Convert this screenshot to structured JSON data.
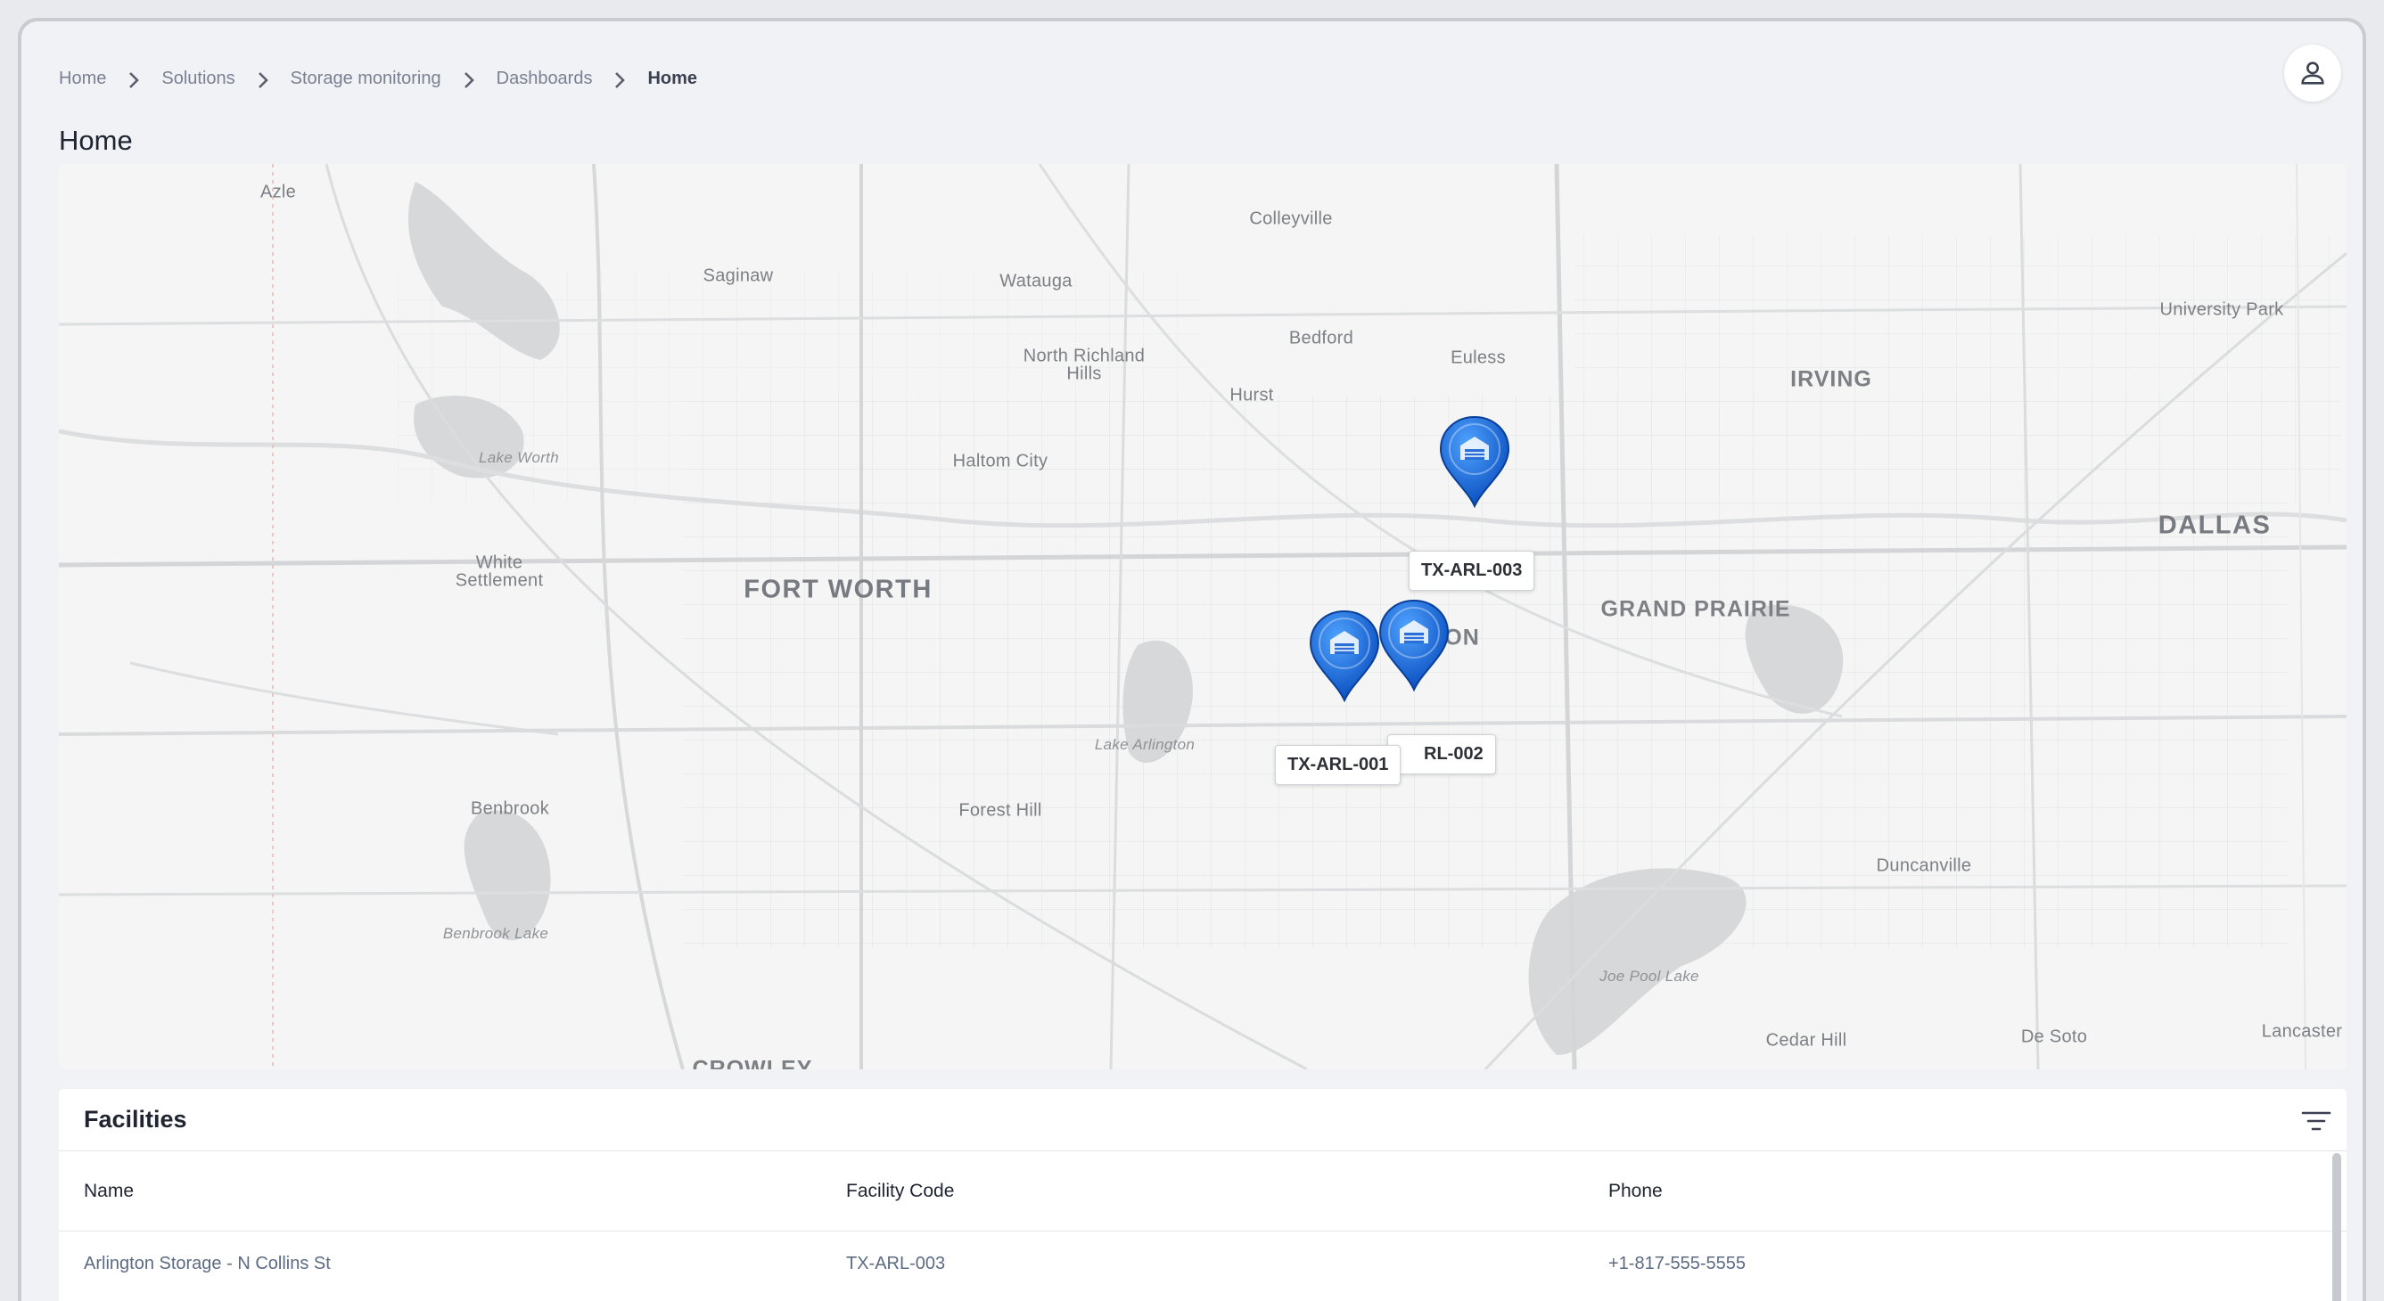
{
  "breadcrumb": {
    "items": [
      "Home",
      "Solutions",
      "Storage monitoring",
      "Dashboards",
      "Home"
    ]
  },
  "page": {
    "title": "Home"
  },
  "map": {
    "places": [
      {
        "name": "Azle",
        "kind": "small"
      },
      {
        "name": "Colleyville",
        "kind": "small"
      },
      {
        "name": "Saginaw",
        "kind": "small"
      },
      {
        "name": "Watauga",
        "kind": "small"
      },
      {
        "name": "North Richland",
        "kind": "small"
      },
      {
        "name": "Hills",
        "kind": "small"
      },
      {
        "name": "Bedford",
        "kind": "small"
      },
      {
        "name": "Euless",
        "kind": "small"
      },
      {
        "name": "Hurst",
        "kind": "small"
      },
      {
        "name": "University Park",
        "kind": "small"
      },
      {
        "name": "IRVING",
        "kind": "mid"
      },
      {
        "name": "Lake Worth",
        "kind": "water"
      },
      {
        "name": "Haltom City",
        "kind": "small"
      },
      {
        "name": "DALLAS",
        "kind": "big"
      },
      {
        "name": "White",
        "kind": "small"
      },
      {
        "name": "Settlement",
        "kind": "small"
      },
      {
        "name": "FORT WORTH",
        "kind": "big"
      },
      {
        "name": "GRAND PRAIRIE",
        "kind": "mid"
      },
      {
        "name": "ON",
        "kind": "mid"
      },
      {
        "name": "Lake Arlington",
        "kind": "water"
      },
      {
        "name": "Benbrook",
        "kind": "small"
      },
      {
        "name": "Forest Hill",
        "kind": "small"
      },
      {
        "name": "Duncanville",
        "kind": "small"
      },
      {
        "name": "Benbrook Lake",
        "kind": "water"
      },
      {
        "name": "Joe Pool Lake",
        "kind": "water"
      },
      {
        "name": "CROWLEY",
        "kind": "mid"
      },
      {
        "name": "Cedar Hill",
        "kind": "small"
      },
      {
        "name": "De Soto",
        "kind": "small"
      },
      {
        "name": "Lancaster",
        "kind": "small"
      }
    ],
    "markers": [
      {
        "code": "TX-ARL-003",
        "label": "TX-ARL-003"
      },
      {
        "code": "TX-ARL-002",
        "label": "RL-002"
      },
      {
        "code": "TX-ARL-001",
        "label": "TX-ARL-001"
      }
    ],
    "marker_color": "#1565d8"
  },
  "facilities": {
    "title": "Facilities",
    "columns": [
      "Name",
      "Facility Code",
      "Phone"
    ],
    "rows": [
      {
        "name": "Arlington Storage - N Collins St",
        "code": "TX-ARL-003",
        "phone": "+1-817-555-5555"
      }
    ]
  },
  "icons": {
    "breadcrumb_separator": "chevron-right-icon",
    "user": "user-icon",
    "filter": "filter-icon",
    "marker": "map-pin-icon"
  }
}
